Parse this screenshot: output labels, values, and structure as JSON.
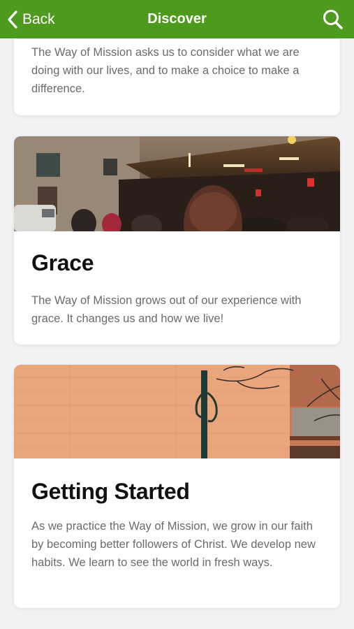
{
  "nav": {
    "back_label": "Back",
    "title": "Discover",
    "bar_color": "#4e9a1f"
  },
  "cards": [
    {
      "title": "",
      "description": "The Way of Mission asks us to consider what we are doing with our lives, and to make a choice to make a difference."
    },
    {
      "title": "Grace",
      "description": "The Way of Mission grows out of our experience with grace. It changes us and how we live!",
      "image": "cafe-street-scene"
    },
    {
      "title": "Getting Started",
      "description": "As we practice the Way of Mission, we grow in our faith by becoming better followers of Christ. We develop new habits. We learn to see the world in fresh ways.",
      "image": "brick-wall-lamp-post"
    }
  ]
}
